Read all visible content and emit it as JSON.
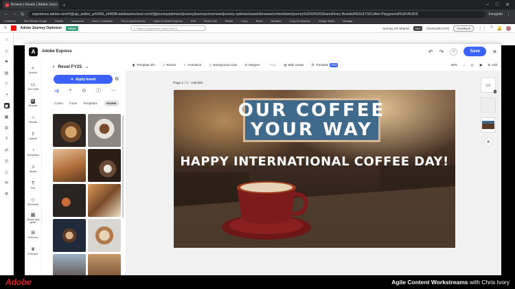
{
  "browser": {
    "tab_title": "Browse | Assets | Adobe Journ",
    "new_tab": "+",
    "url": "experience.adobe.com/#/@ajo_author_p42409_e94698-adobeaemcloud.com#/@journeyoptimizer/journey/journeys/overview/journey-optimize/assets/browse/content/dam/journey%20X0%20Shared/Ivory Brands/RESULTS/Coffee Playground/%3Fd%3D0",
    "incognito": "Incognito"
  },
  "bookmarks": [
    "Collected",
    "Find Similar Image",
    "Details",
    "Download",
    "Add to Collection",
    "Pin to Quick Access",
    "Open in Adobe Express",
    "Edit",
    "Share Link",
    "Delete",
    "Copy",
    "Move",
    "Rename",
    "Copy to Libraries",
    "Assign Tasks",
    "Manage"
  ],
  "app": {
    "name": "Adobe Journey Optimizer",
    "env": "PROD",
    "search_placeholder": "Search Experience Cloud (Ctrl+/)",
    "sandbox": "Journey US Shared",
    "dev": "Dev",
    "org": "CleverySB (V47)",
    "feedback": "Feedback"
  },
  "express": {
    "name": "Adobe Express",
    "save": "Save"
  },
  "nav": [
    {
      "label": "Search",
      "icon": "search-icon"
    },
    {
      "label": "Your stuff",
      "icon": "folder-icon"
    },
    {
      "label": "Brands",
      "icon": "brand-icon"
    },
    {
      "label": "Visuals",
      "icon": "shapes-icon"
    },
    {
      "label": "Upload",
      "icon": "upload-icon"
    },
    {
      "label": "Templates",
      "icon": "templates-icon"
    },
    {
      "label": "Media",
      "icon": "media-icon"
    },
    {
      "label": "Text",
      "icon": "text-icon"
    },
    {
      "label": "Elements",
      "icon": "elements-icon"
    },
    {
      "label": "Charts and grids",
      "icon": "charts-icon"
    },
    {
      "label": "Add-ons",
      "icon": "addons-icon"
    },
    {
      "label": "Premium",
      "icon": "premium-icon"
    }
  ],
  "brand": {
    "name": "Revel FY25",
    "apply": "Apply brand",
    "tabs": [
      "Colors",
      "Fonts",
      "Templates",
      "Assets"
    ],
    "active_tab": "Assets"
  },
  "toolbar": {
    "template_info": "Template info",
    "resize": "Resize",
    "animation": "Animation",
    "background": "Background color",
    "margins": "Margins",
    "align": "Align",
    "bulk": "Bulk create",
    "translate": "Translate",
    "new_badge": "NEW",
    "zoom": "58%",
    "add": "Add"
  },
  "canvas": {
    "page_label": "Page 1 / 1 - Add title",
    "page_count": "2"
  },
  "poster": {
    "line1": "OUR COFFEE",
    "line2": "YOUR WAY",
    "tagline": "HAPPY INTERNATIONAL COFFEE DAY!"
  },
  "footer": {
    "brand": "Adobe",
    "series": "Agile Content Workstreams",
    "presenter": "with Chris Ivory"
  }
}
